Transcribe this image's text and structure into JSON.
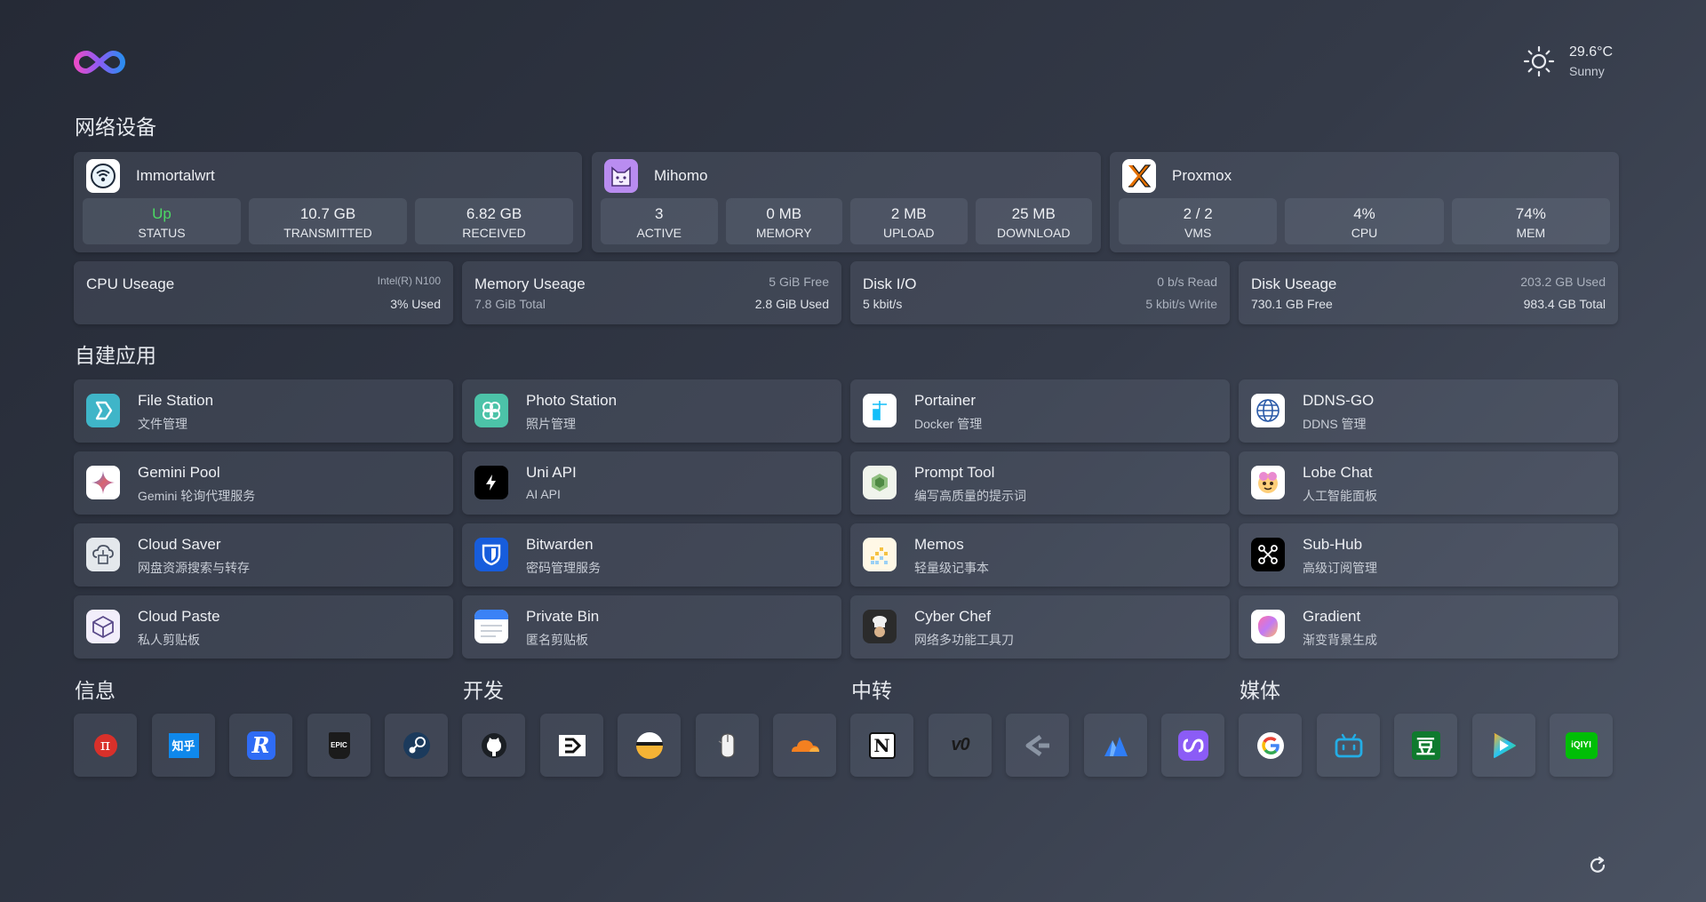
{
  "weather": {
    "temperature": "29.6°C",
    "condition": "Sunny",
    "icon": "sun-icon"
  },
  "sections": {
    "network": "网络设备",
    "apps": "自建应用",
    "info": "信息",
    "dev": "开发",
    "relay": "中转",
    "media": "媒体"
  },
  "services": [
    {
      "name": "Immortalwrt",
      "icon": "wifi-router-icon",
      "stats": [
        {
          "value": "Up",
          "label": "STATUS",
          "color": "#4cd964"
        },
        {
          "value": "10.7 GB",
          "label": "TRANSMITTED"
        },
        {
          "value": "6.82 GB",
          "label": "RECEIVED"
        }
      ]
    },
    {
      "name": "Mihomo",
      "icon": "cat-icon",
      "stats": [
        {
          "value": "3",
          "label": "ACTIVE"
        },
        {
          "value": "0 MB",
          "label": "MEMORY"
        },
        {
          "value": "2 MB",
          "label": "UPLOAD"
        },
        {
          "value": "25 MB",
          "label": "DOWNLOAD"
        }
      ]
    },
    {
      "name": "Proxmox",
      "icon": "proxmox-icon",
      "stats": [
        {
          "value": "2 / 2",
          "label": "VMS"
        },
        {
          "value": "4%",
          "label": "CPU"
        },
        {
          "value": "74%",
          "label": "MEM"
        }
      ]
    }
  ],
  "resources": [
    {
      "name": "CPU Useage",
      "sub": "",
      "r1": "Intel(R) N100",
      "r2": "3% Used"
    },
    {
      "name": "Memory Useage",
      "sub": "7.8 GiB Total",
      "r1": "5 GiB Free",
      "r2": "2.8 GiB Used"
    },
    {
      "name": "Disk I/O",
      "sub": "5 kbit/s",
      "r1": "0 b/s Read",
      "r2": "5 kbit/s Write"
    },
    {
      "name": "Disk Useage",
      "sub": "730.1 GB Free",
      "r1": "203.2 GB Used",
      "r2": "983.4 GB Total"
    }
  ],
  "apps": [
    {
      "title": "File Station",
      "desc": "文件管理",
      "icon": "file-station-icon"
    },
    {
      "title": "Photo Station",
      "desc": "照片管理",
      "icon": "photo-station-icon"
    },
    {
      "title": "Portainer",
      "desc": "Docker 管理",
      "icon": "portainer-icon"
    },
    {
      "title": "DDNS-GO",
      "desc": "DDNS 管理",
      "icon": "globe-icon"
    },
    {
      "title": "Gemini Pool",
      "desc": "Gemini 轮询代理服务",
      "icon": "gemini-sparkle-icon"
    },
    {
      "title": "Uni API",
      "desc": "AI API",
      "icon": "lightning-icon"
    },
    {
      "title": "Prompt Tool",
      "desc": "编写高质量的提示词",
      "icon": "prompt-tool-icon"
    },
    {
      "title": "Lobe Chat",
      "desc": "人工智能面板",
      "icon": "lobe-chat-icon"
    },
    {
      "title": "Cloud Saver",
      "desc": "网盘资源搜索与转存",
      "icon": "cloud-saver-icon"
    },
    {
      "title": "Bitwarden",
      "desc": "密码管理服务",
      "icon": "shield-icon"
    },
    {
      "title": "Memos",
      "desc": "轻量级记事本",
      "icon": "memos-icon"
    },
    {
      "title": "Sub-Hub",
      "desc": "高级订阅管理",
      "icon": "sub-hub-icon"
    },
    {
      "title": "Cloud Paste",
      "desc": "私人剪贴板",
      "icon": "box-icon"
    },
    {
      "title": "Private Bin",
      "desc": "匿名剪贴板",
      "icon": "note-icon"
    },
    {
      "title": "Cyber Chef",
      "desc": "网络多功能工具刀",
      "icon": "chef-icon"
    },
    {
      "title": "Gradient",
      "desc": "渐变背景生成",
      "icon": "gradient-icon"
    }
  ],
  "links": [
    {
      "icon": "pi-icon",
      "text": "π"
    },
    {
      "icon": "zhihu-icon",
      "text": "知乎"
    },
    {
      "icon": "reeder-icon",
      "text": "R"
    },
    {
      "icon": "epic-games-icon",
      "text": "EPIC"
    },
    {
      "icon": "steam-icon",
      "text": ""
    },
    {
      "icon": "github-icon",
      "text": ""
    },
    {
      "icon": "terminal-icon",
      "text": ""
    },
    {
      "icon": "bar-icon",
      "text": ""
    },
    {
      "icon": "mouse-icon",
      "text": ""
    },
    {
      "icon": "cloudflare-icon",
      "text": ""
    },
    {
      "icon": "notion-icon",
      "text": "N"
    },
    {
      "icon": "v0-icon",
      "text": "v0"
    },
    {
      "icon": "chevron-icon",
      "text": ""
    },
    {
      "icon": "mountain-icon",
      "text": ""
    },
    {
      "icon": "infinity-icon",
      "text": ""
    },
    {
      "icon": "google-icon",
      "text": "G"
    },
    {
      "icon": "bilibili-icon",
      "text": ""
    },
    {
      "icon": "douban-icon",
      "text": "豆"
    },
    {
      "icon": "play-icon",
      "text": ""
    },
    {
      "icon": "iqiyi-icon",
      "text": "iQIYI"
    }
  ]
}
